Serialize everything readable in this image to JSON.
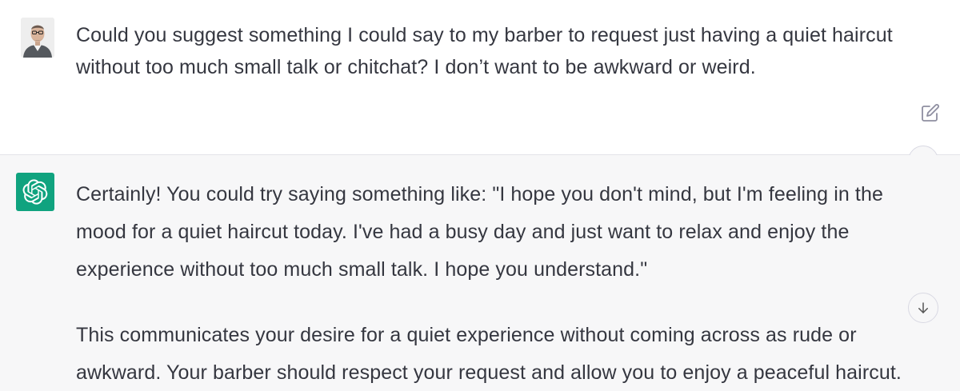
{
  "conversation": {
    "user_message": {
      "lines": [
        "Could you suggest something I could say to my barber to request just having a quiet haircut",
        "without too much small talk or chitchat? I don’t want to be awkward or weird."
      ],
      "avatar": "user-photo",
      "edit_icon": "pencil-square-icon"
    },
    "assistant_message": {
      "avatar": "openai-logo",
      "paragraph_1_lines": [
        "Certainly! You could try saying something like: \"I hope you don't mind, but I'm feeling in the",
        "mood for a quiet haircut today. I've had a busy day and just want to relax and enjoy the",
        "experience without too much small talk. I hope you understand.\""
      ],
      "paragraph_2_lines": [
        "This communicates your desire for a quiet experience without coming across as rude or",
        "awkward. Your barber should respect your request and allow you to enjoy a peaceful haircut."
      ]
    },
    "scroll_icon": "arrow-down-icon"
  },
  "colors": {
    "assistant_bg": "#f7f7f8",
    "brand_green": "#10a37f",
    "text": "#353740"
  }
}
